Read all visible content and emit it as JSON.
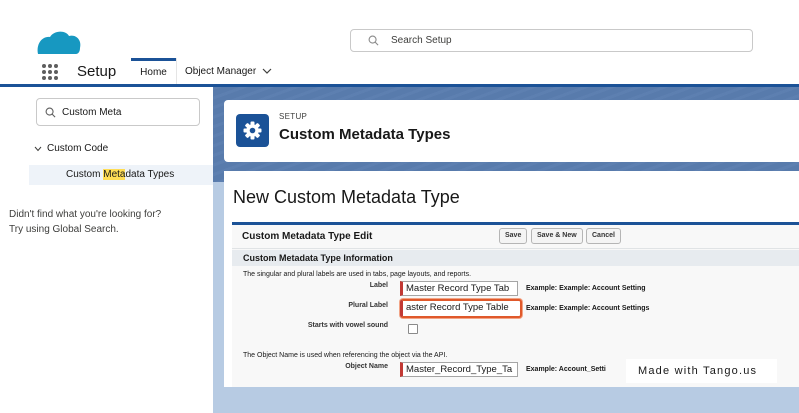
{
  "header": {
    "search_placeholder": "Search Setup"
  },
  "nav": {
    "app_name": "Setup",
    "tabs": [
      {
        "label": "Home",
        "active": true
      },
      {
        "label": "Object Manager",
        "has_dropdown": true
      }
    ]
  },
  "sidebar": {
    "quick_find_value": "Custom Meta",
    "tree_node": "Custom Code",
    "tree_leaf_prefix": "Custom ",
    "tree_leaf_highlight": "Meta",
    "tree_leaf_suffix": "data Types",
    "help_line1": "Didn't find what you're looking for?",
    "help_line2": "Try using Global Search."
  },
  "setup_header": {
    "eyebrow": "SETUP",
    "title": "Custom Metadata Types",
    "icon": "gear-icon"
  },
  "edit_page": {
    "title": "New Custom Metadata Type",
    "block_title": "Custom Metadata Type Edit",
    "buttons": {
      "save": "Save",
      "save_new": "Save & New",
      "cancel": "Cancel"
    },
    "section_title": "Custom Metadata Type Information",
    "intro_text": "The singular and plural labels are used in tabs, page layouts, and reports.",
    "fields": {
      "label": {
        "label": "Label",
        "value": "Master Record Type Tab",
        "example": "Example:  Example: Account Setting"
      },
      "plural_label": {
        "label": "Plural Label",
        "value": "aster Record Type Table",
        "example": "Example:  Example: Account Settings"
      },
      "vowel": {
        "label": "Starts with vowel sound",
        "checked": false
      },
      "object_name": {
        "label": "Object Name",
        "value": "Master_Record_Type_Ta",
        "example": "Example:  Account_Setti"
      }
    },
    "object_intro_text": "The Object Name is used when referencing the object via the API."
  },
  "watermark": "Made with Tango.us",
  "colors": {
    "brand_blue": "#1b5297",
    "required_red": "#c23934",
    "focus_orange": "#e0592b",
    "highlight_yellow": "#ffdd55"
  }
}
